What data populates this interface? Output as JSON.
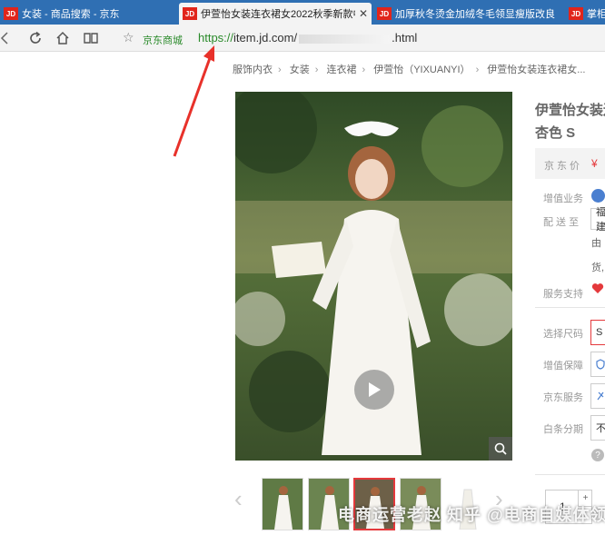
{
  "tabs": [
    {
      "label": "女装 - 商品搜索 - 京东",
      "active": false
    },
    {
      "label": "伊萱怡女装连衣裙女2022秋季新款中",
      "active": true
    },
    {
      "label": "加厚秋冬烫金加绒冬毛领显瘦版改良",
      "active": false
    },
    {
      "label": "掌柜",
      "active": false
    }
  ],
  "toolbar": {
    "site_label": "京东商城",
    "url_protocol": "https://",
    "url_host": "item.jd.com/",
    "url_tail": ".html"
  },
  "breadcrumb": [
    "服饰内衣",
    "女装",
    "连衣裙",
    "伊萱怡（YIXUANYI）",
    "伊萱怡女装连衣裙女..."
  ],
  "product": {
    "title": "伊萱怡女装连",
    "subtitle": "杏色 S",
    "price_label": "京东价",
    "price_symbol": "¥"
  },
  "info": {
    "value_add_label": "增值业务",
    "delivery_label": "配 送 至",
    "delivery_value": "福建",
    "from_text": "由",
    "goods_text": "货,",
    "service_support_label": "服务支持",
    "size_label": "选择尺码",
    "size_value": "S",
    "protect_label": "增值保障",
    "jd_service_label": "京东服务",
    "installment_label": "白条分期",
    "installment_value": "不"
  },
  "purchase": {
    "quantity": "1",
    "plus": "+"
  },
  "thumbnails": [
    {
      "active": false
    },
    {
      "active": false
    },
    {
      "active": true
    },
    {
      "active": false
    },
    {
      "active": false
    }
  ],
  "watermark": "电商运营老赵 知乎 @电商自媒体领域",
  "colors": {
    "tab_bar": "#2f6fb3",
    "jd_red": "#e1251b",
    "accent_red": "#e4393c",
    "url_green": "#2a8a2a",
    "annotation_red": "#e8312a"
  },
  "icons": [
    "back-icon",
    "refresh-icon",
    "home-icon",
    "book-icon",
    "star-icon",
    "play-icon",
    "zoom-icon",
    "heart-icon",
    "help-icon"
  ]
}
